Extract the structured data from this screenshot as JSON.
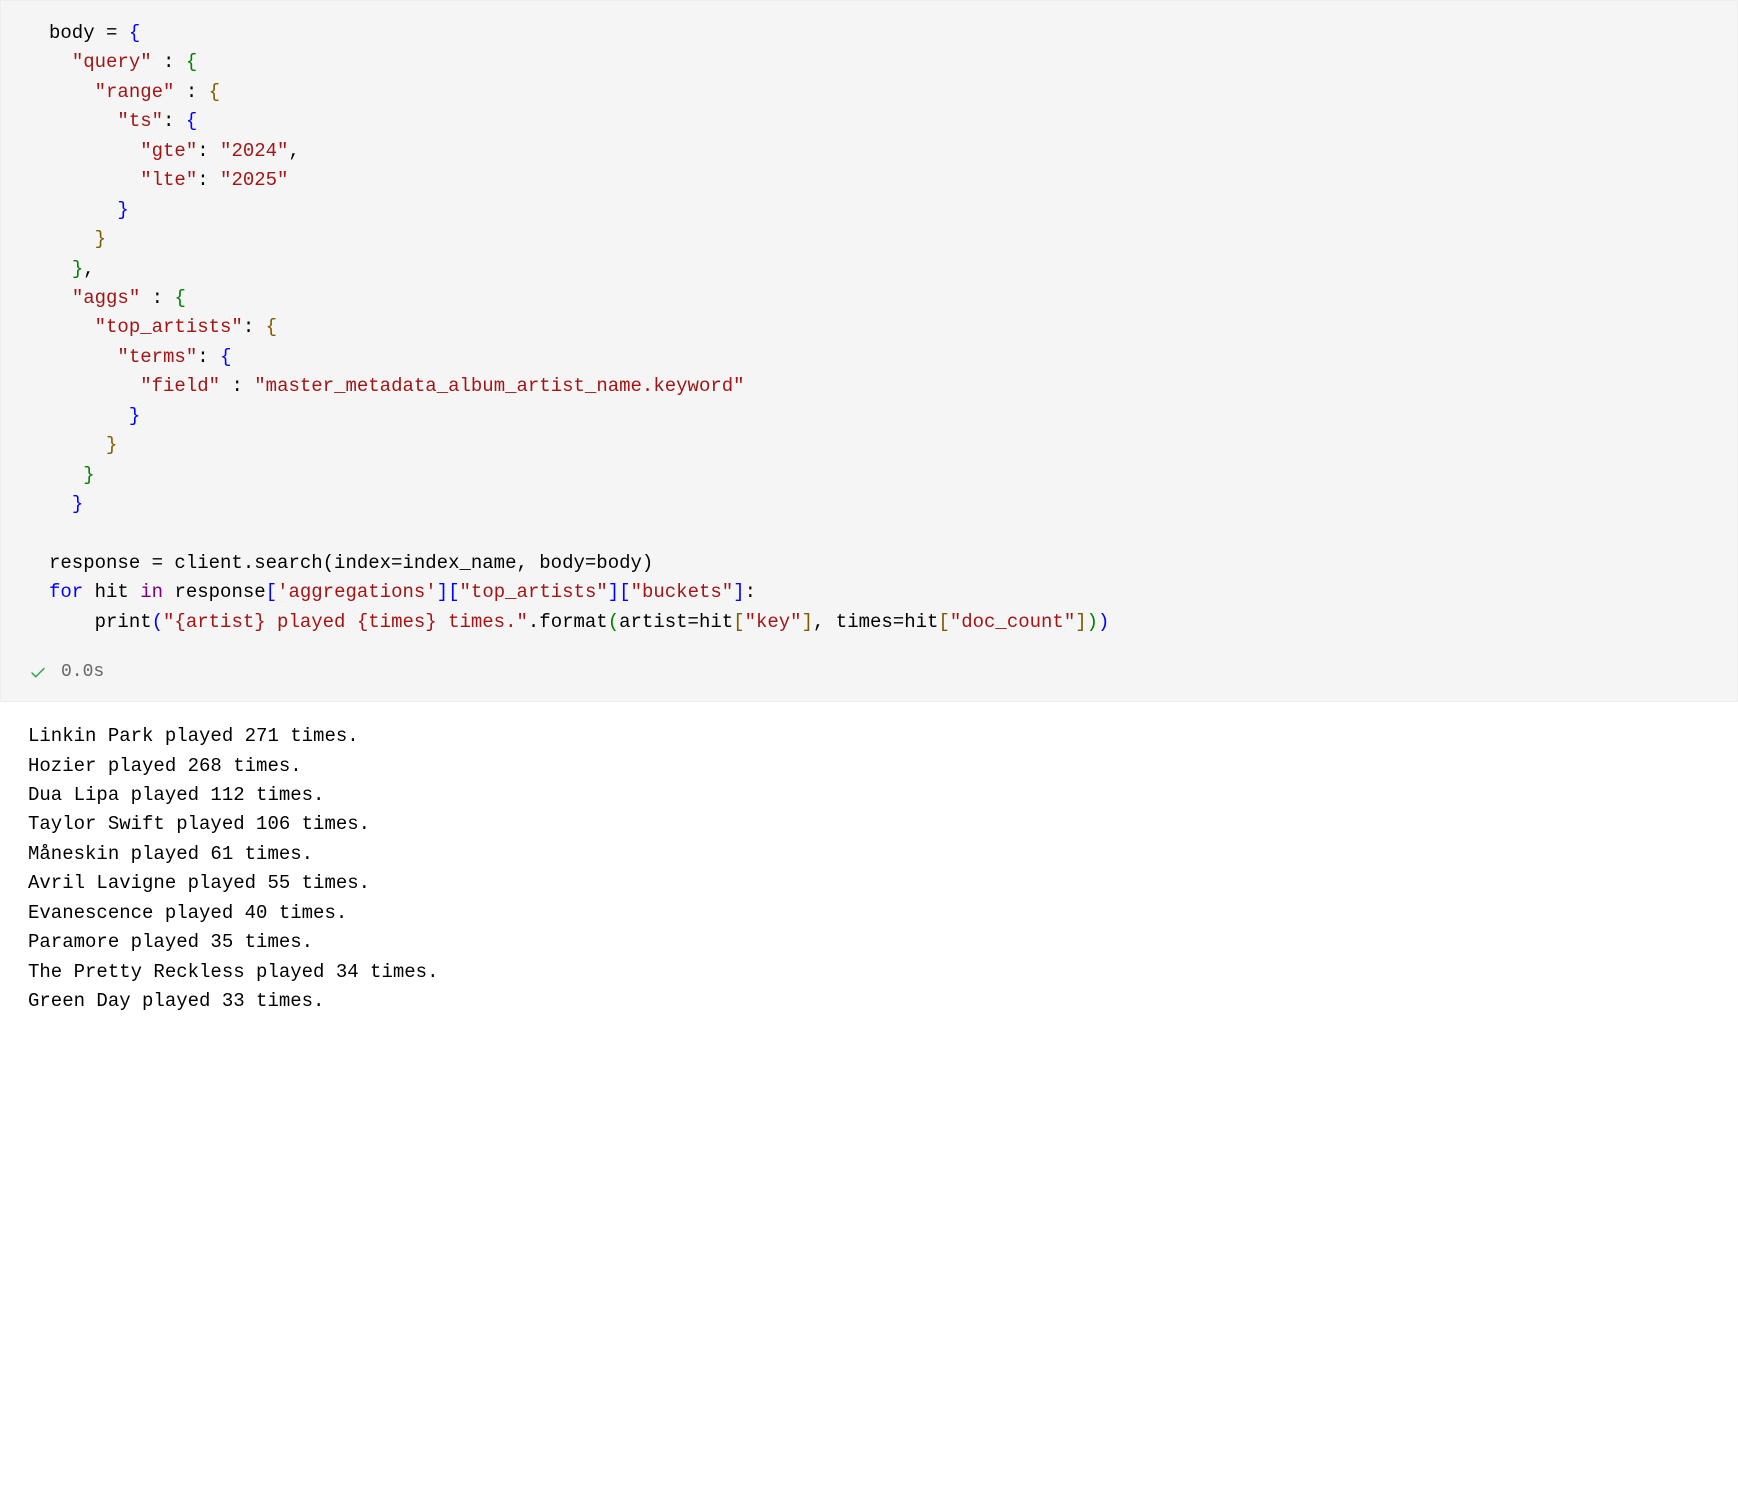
{
  "code": {
    "var_body": "body",
    "eq": " = ",
    "open_brace": "{",
    "close_brace": "}",
    "comma": ",",
    "colon": ":",
    "key_query": "\"query\"",
    "key_range": "\"range\"",
    "key_ts": "\"ts\"",
    "key_gte": "\"gte\"",
    "val_2024": "\"2024\"",
    "key_lte": "\"lte\"",
    "val_2025": "\"2025\"",
    "key_aggs": "\"aggs\"",
    "key_top_artists": "\"top_artists\"",
    "key_terms": "\"terms\"",
    "key_field": "\"field\"",
    "val_field": "\"master_metadata_album_artist_name.keyword\"",
    "line_response": "response = client.search(index=index_name, body=body)",
    "kw_for": "for",
    "var_hit": " hit ",
    "kw_in": "in",
    "resp_access": " response",
    "idx_aggregations": "'aggregations'",
    "idx_top_artists": "\"top_artists\"",
    "idx_buckets": "\"buckets\"",
    "print_name": "print",
    "fmt_string": "\"{artist} played {times} times.\"",
    "fmt_method": ".format",
    "fmt_artist_kw": "artist=hit",
    "fmt_key_key": "\"key\"",
    "fmt_times_kw": ", times=hit",
    "fmt_key_doc": "\"doc_count\""
  },
  "status": {
    "check": "✓",
    "time": "0.0s"
  },
  "output": [
    "Linkin Park played 271 times.",
    "Hozier played 268 times.",
    "Dua Lipa played 112 times.",
    "Taylor Swift played 106 times.",
    "Måneskin played 61 times.",
    "Avril Lavigne played 55 times.",
    "Evanescence played 40 times.",
    "Paramore played 35 times.",
    "The Pretty Reckless played 34 times.",
    "Green Day played 33 times."
  ]
}
